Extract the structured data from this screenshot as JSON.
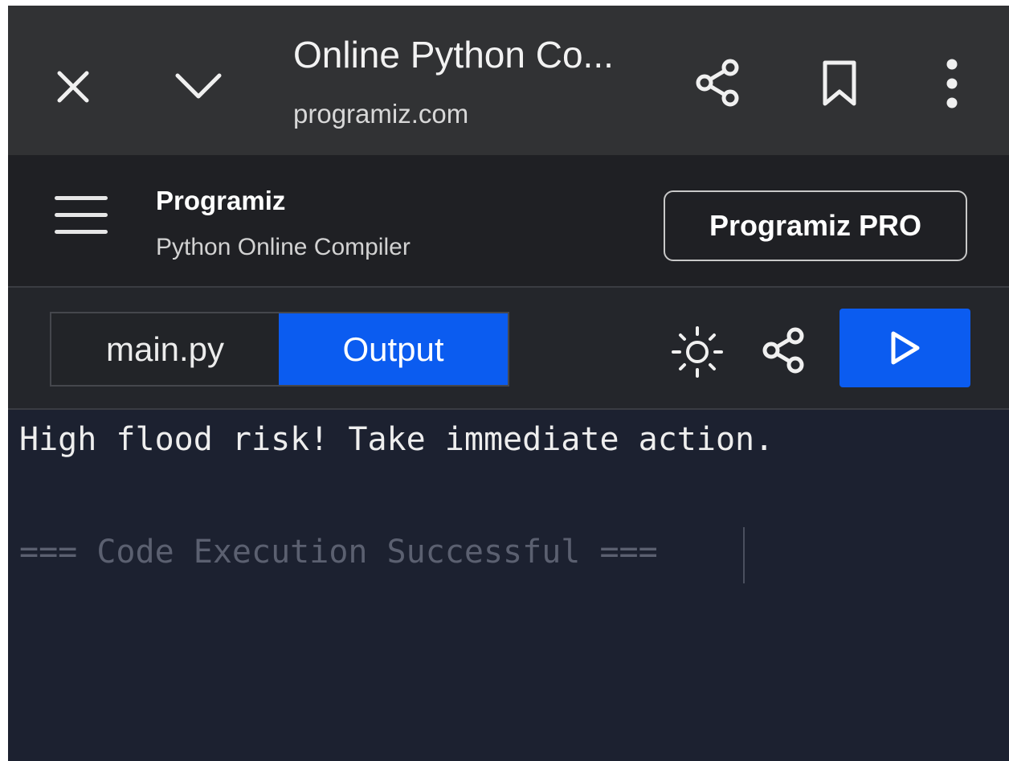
{
  "browser_bar": {
    "title": "Online Python Co...",
    "url": "programiz.com",
    "close_icon": "close-icon",
    "collapse_icon": "chevron-down-icon",
    "share_icon": "share-icon",
    "bookmark_icon": "bookmark-icon",
    "menu_icon": "more-vertical-icon"
  },
  "site_header": {
    "menu_icon": "hamburger-icon",
    "brand": "Programiz",
    "subtitle": "Python Online Compiler",
    "pro_button": "Programiz PRO"
  },
  "toolbar": {
    "tabs": [
      {
        "label": "main.py",
        "active": false
      },
      {
        "label": "Output",
        "active": true
      }
    ],
    "theme_icon": "sun-icon",
    "share_icon": "share-icon",
    "run_icon": "play-icon"
  },
  "console": {
    "output": "High flood risk! Take immediate action.",
    "status": "=== Code Execution Successful ==="
  },
  "colors": {
    "accent": "#0b5cf0",
    "console_bg": "#1c2130",
    "browser_bar_bg": "#313234"
  }
}
